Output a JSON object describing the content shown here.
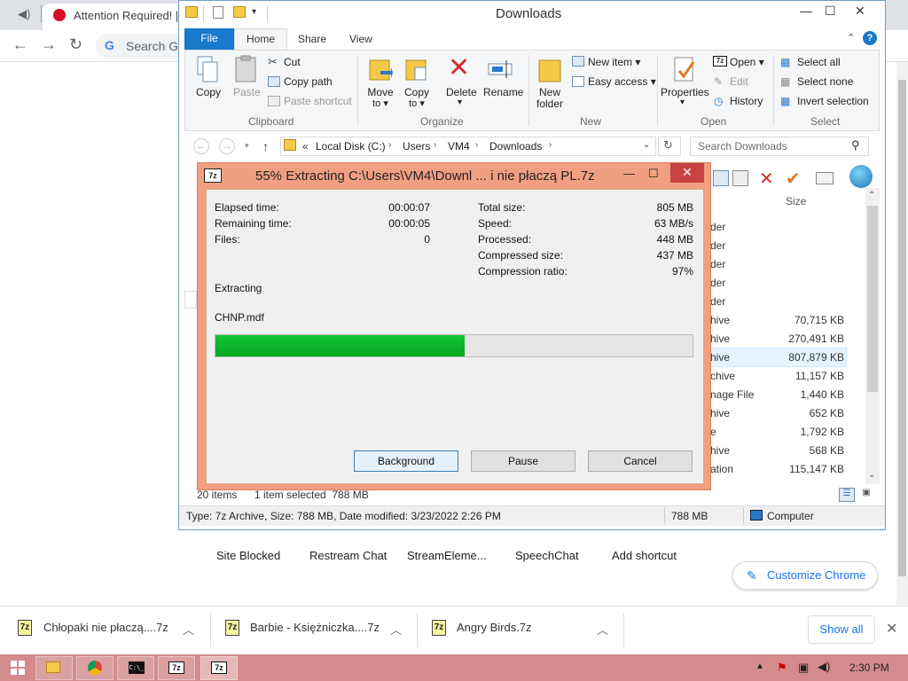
{
  "chrome": {
    "tab_title": "Attention Required! | C",
    "omnibox_placeholder": "Search Go",
    "shortcuts": [
      "Site Blocked",
      "Restream Chat",
      "StreamEleme...",
      "SpeechChat",
      "Add shortcut"
    ],
    "customize_label": "Customize Chrome",
    "downloads": [
      {
        "name": "Chłopaki nie płaczą....7z"
      },
      {
        "name": "Barbie - Księżniczka....7z"
      },
      {
        "name": "Angry Birds.7z"
      }
    ],
    "show_all": "Show all",
    "icon_7z_label": "7z"
  },
  "explorer": {
    "title": "Downloads",
    "tabs": {
      "file": "File",
      "home": "Home",
      "share": "Share",
      "view": "View"
    },
    "ribbon": {
      "clipboard": {
        "label": "Clipboard",
        "copy": "Copy",
        "paste": "Paste",
        "cut": "Cut",
        "copy_path": "Copy path",
        "paste_shortcut": "Paste shortcut"
      },
      "organize": {
        "label": "Organize",
        "move_to": "Move",
        "move_to_2": "to ▾",
        "copy_to": "Copy",
        "copy_to_2": "to ▾",
        "delete": "Delete",
        "delete_arrow": "▾",
        "rename": "Rename"
      },
      "new": {
        "label": "New",
        "new_folder": "New",
        "new_folder_2": "folder",
        "new_item": "New item ▾",
        "easy_access": "Easy access ▾"
      },
      "open": {
        "label": "Open",
        "properties": "Properties",
        "properties_arrow": "▾",
        "open": "Open ▾",
        "edit": "Edit",
        "history": "History",
        "open_icon_label": "7z"
      },
      "select": {
        "label": "Select",
        "select_all": "Select all",
        "select_none": "Select none",
        "invert": "Invert selection"
      }
    },
    "address": {
      "prefix": "«",
      "crumbs": [
        "Local Disk (C:)",
        "Users",
        "VM4",
        "Downloads"
      ]
    },
    "search_placeholder": "Search Downloads",
    "size_header": "Size",
    "rows": [
      {
        "type": "der",
        "size": ""
      },
      {
        "type": "der",
        "size": ""
      },
      {
        "type": "der",
        "size": ""
      },
      {
        "type": "der",
        "size": ""
      },
      {
        "type": "der",
        "size": ""
      },
      {
        "type": "hive",
        "size": "70,715 KB"
      },
      {
        "type": "hive",
        "size": "270,491 KB"
      },
      {
        "type": "hive",
        "size": "807,879 KB"
      },
      {
        "type": "chive",
        "size": "11,157 KB"
      },
      {
        "type": "nage File",
        "size": "1,440 KB"
      },
      {
        "type": "hive",
        "size": "652 KB"
      },
      {
        "type": "e",
        "size": "1,792 KB"
      },
      {
        "type": "hive",
        "size": "568 KB"
      },
      {
        "type": "ation",
        "size": "115,147 KB"
      }
    ],
    "status_items": "20 items",
    "status_selected": "1 item selected  788 MB",
    "details_text": "Type: 7z Archive, Size: 788 MB, Date modified: 3/23/2022 2:26 PM",
    "details_size": "788 MB",
    "details_location": "Computer"
  },
  "dialog": {
    "title": "55% Extracting C:\\Users\\VM4\\Downl ... i nie płaczą PL.7z",
    "icon_label": "7z",
    "left": [
      {
        "label": "Elapsed time:",
        "value": "00:00:07"
      },
      {
        "label": "Remaining time:",
        "value": "00:00:05"
      },
      {
        "label": "Files:",
        "value": "0"
      }
    ],
    "right": [
      {
        "label": "Total size:",
        "value": "805 MB"
      },
      {
        "label": "Speed:",
        "value": "63 MB/s"
      },
      {
        "label": "Processed:",
        "value": "448 MB"
      },
      {
        "label": "Compressed size:",
        "value": "437 MB"
      },
      {
        "label": "Compression ratio:",
        "value": "97%"
      }
    ],
    "status": "Extracting",
    "current_file": "CHNP.mdf",
    "progress_percent": 55,
    "buttons": {
      "background": "Background",
      "pause": "Pause",
      "cancel": "Cancel"
    }
  },
  "taskbar": {
    "time": "2:30 PM",
    "cmd_label": "C:\\_",
    "sevenzip_label_1": "7z",
    "sevenzip_label_2": "7z"
  },
  "colors": {
    "accent": "#1979ca",
    "dialog_frame": "#f0a080",
    "progress": "#06b025",
    "taskbar": "#d48b8b"
  }
}
